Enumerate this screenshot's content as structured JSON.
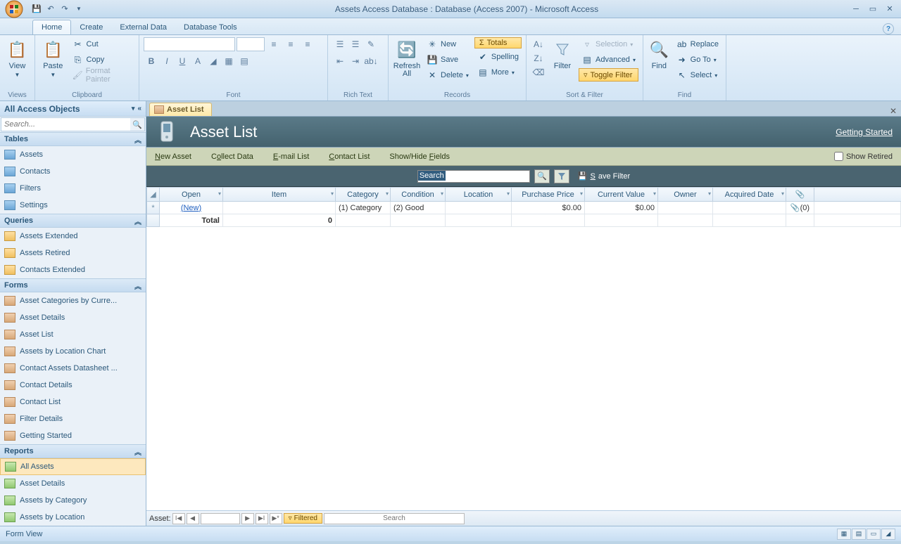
{
  "title": "Assets Access Database : Database (Access 2007) - Microsoft Access",
  "tabs": {
    "home": "Home",
    "create": "Create",
    "external": "External Data",
    "dbtools": "Database Tools"
  },
  "ribbon": {
    "views": {
      "label": "Views",
      "view": "View"
    },
    "clipboard": {
      "label": "Clipboard",
      "paste": "Paste",
      "cut": "Cut",
      "copy": "Copy",
      "painter": "Format Painter"
    },
    "font": {
      "label": "Font"
    },
    "richtext": {
      "label": "Rich Text"
    },
    "records": {
      "label": "Records",
      "refresh": "Refresh\nAll",
      "new": "New",
      "save": "Save",
      "delete": "Delete",
      "totals": "Totals",
      "spelling": "Spelling",
      "more": "More"
    },
    "sortfilter": {
      "label": "Sort & Filter",
      "filter": "Filter",
      "selection": "Selection",
      "advanced": "Advanced",
      "toggle": "Toggle Filter"
    },
    "find": {
      "label": "Find",
      "find": "Find",
      "replace": "Replace",
      "goto": "Go To",
      "select": "Select"
    }
  },
  "nav": {
    "title": "All Access Objects",
    "search_placeholder": "Search...",
    "tables": {
      "label": "Tables",
      "items": [
        "Assets",
        "Contacts",
        "Filters",
        "Settings"
      ]
    },
    "queries": {
      "label": "Queries",
      "items": [
        "Assets Extended",
        "Assets Retired",
        "Contacts Extended"
      ]
    },
    "forms": {
      "label": "Forms",
      "items": [
        "Asset Categories by Curre...",
        "Asset Details",
        "Asset List",
        "Assets by Location Chart",
        "Contact Assets Datasheet ...",
        "Contact Details",
        "Contact List",
        "Filter Details",
        "Getting Started"
      ]
    },
    "reports": {
      "label": "Reports",
      "items": [
        "All Assets",
        "Asset Details",
        "Assets by Category",
        "Assets by Location"
      ]
    }
  },
  "doc": {
    "tab": "Asset List",
    "title": "Asset List",
    "getting_started": "Getting Started",
    "toolbar": {
      "new": "New Asset",
      "collect": "Collect Data",
      "email": "E-mail List",
      "contact": "Contact List",
      "showhide": "Show/Hide Fields",
      "showretired": "Show Retired"
    },
    "search_text": "Search",
    "save_filter": "Save Filter",
    "columns": [
      "Open",
      "Item",
      "Category",
      "Condition",
      "Location",
      "Purchase Price",
      "Current Value",
      "Owner",
      "Acquired Date"
    ],
    "row": {
      "open": "(New)",
      "category": "(1) Category",
      "condition": "(2) Good",
      "purchase": "$0.00",
      "current": "$0.00",
      "attach": "(0)"
    },
    "total": {
      "label": "Total",
      "item": "0"
    },
    "recnav": {
      "label": "Asset:",
      "filtered": "Filtered",
      "search": "Search"
    }
  },
  "status": "Form View"
}
